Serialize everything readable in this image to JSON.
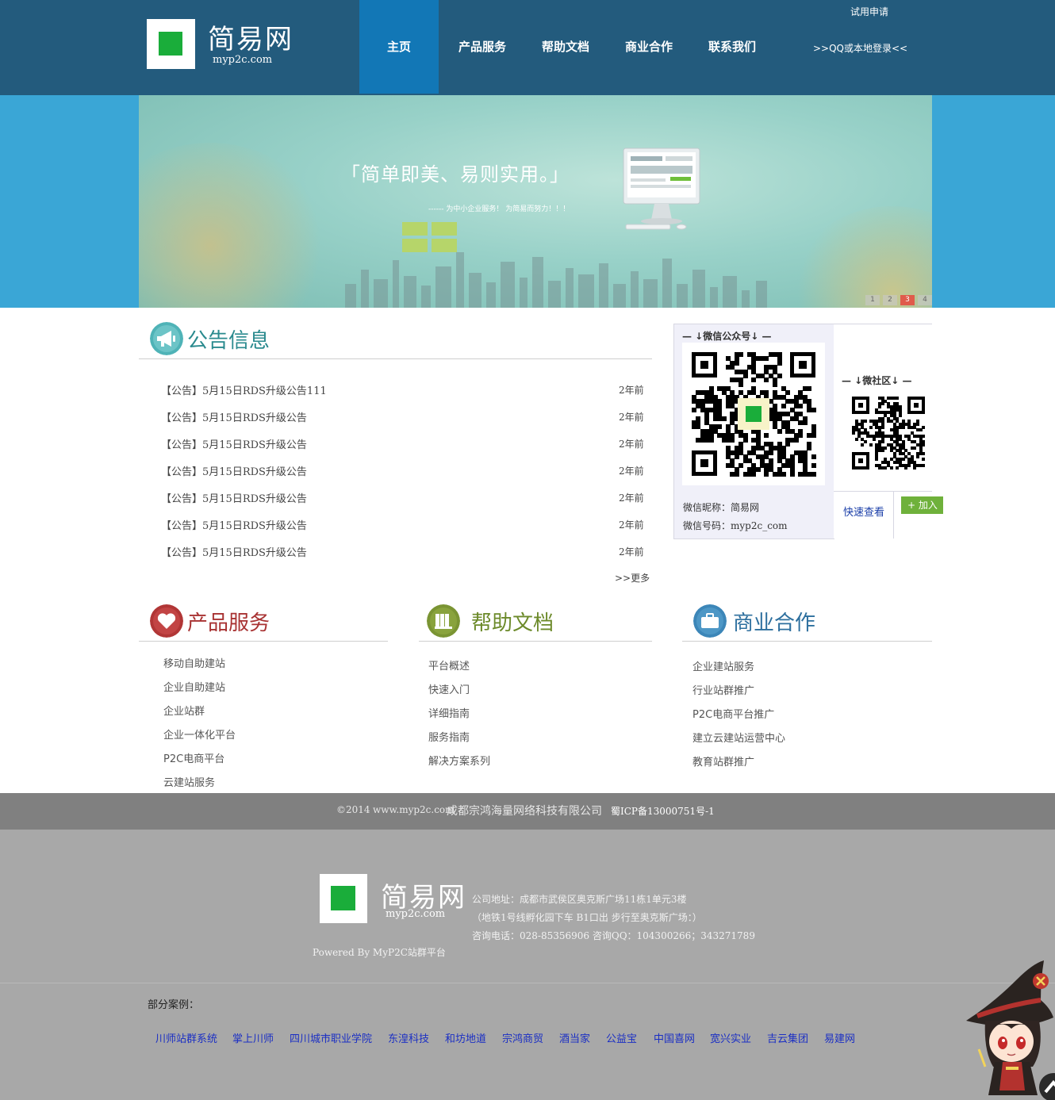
{
  "header": {
    "logo_title": "简易网",
    "logo_sub": "myp2c.com",
    "nav": [
      {
        "label": "主页",
        "active": true
      },
      {
        "label": "产品服务",
        "active": false
      },
      {
        "label": "帮助文档",
        "active": false
      },
      {
        "label": "商业合作",
        "active": false
      },
      {
        "label": "联系我们",
        "active": false
      }
    ],
    "trial_label": "试用申请",
    "qq_login_label": ">>QQ或本地登录<<"
  },
  "banner": {
    "slogan": "「简单即美、易则实用。」",
    "sub": "------ 为中小企业服务！ 为简易而努力！！！",
    "pager": [
      "1",
      "2",
      "3",
      "4"
    ],
    "active_page": "3"
  },
  "notices": {
    "title": "公告信息",
    "items": [
      {
        "title": "【公告】5月15日RDS升级公告111",
        "date": "2年前"
      },
      {
        "title": "【公告】5月15日RDS升级公告",
        "date": "2年前"
      },
      {
        "title": "【公告】5月15日RDS升级公告",
        "date": "2年前"
      },
      {
        "title": "【公告】5月15日RDS升级公告",
        "date": "2年前"
      },
      {
        "title": "【公告】5月15日RDS升级公告",
        "date": "2年前"
      },
      {
        "title": "【公告】5月15日RDS升级公告",
        "date": "2年前"
      },
      {
        "title": "【公告】5月15日RDS升级公告",
        "date": "2年前"
      }
    ],
    "more": ">>更多"
  },
  "wechat": {
    "official_head": "— ↓微信公众号↓ —",
    "community_head": "— ↓微社区↓ —",
    "nickname": "微信昵称：简易网",
    "account": "微信号码：myp2c_com",
    "quick_view": "快速查看",
    "add_label": "+ 加入"
  },
  "products": {
    "title": "产品服务",
    "items": [
      "移动自助建站",
      "企业自助建站",
      "企业站群",
      "企业一体化平台",
      "P2C电商平台",
      "云建站服务"
    ]
  },
  "help": {
    "title": "帮助文档",
    "items": [
      "平台概述",
      "快速入门",
      "详细指南",
      "服务指南",
      "解决方案系列"
    ]
  },
  "cooperation": {
    "title": "商业合作",
    "items": [
      "企业建站服务",
      "行业站群推广",
      "P2C电商平台推广",
      "建立云建站运营中心",
      "教育站群推广"
    ]
  },
  "footbar": {
    "copyright": "©2014",
    "domain": "www.myp2c.com",
    "company": "成都宗鸿海量网络科技有限公司",
    "icp": "蜀ICP备13000751号-1"
  },
  "footer": {
    "logo_title": "简易网",
    "logo_sub": "myp2c.com",
    "address": "公司地址：成都市武侯区奥克斯广场11栋1单元3楼",
    "route": "（地铁1号线孵化园下车 B1口出 步行至奥克斯广场：）",
    "contact": "咨询电话：028-85356906 咨询QQ：104300266；343271789",
    "powered": "Powered By MyP2C站群平台",
    "cases_label": "部分案例：",
    "cases": [
      "川师站群系统",
      "掌上川师",
      "四川城市职业学院",
      "东湟科技",
      "和坊地道",
      "宗鸿商贸",
      "酒当家",
      "公益宝",
      "中国喜网",
      "宽兴实业",
      "吉云集团",
      "易建网"
    ]
  },
  "colors": {
    "header_bg": "#235b7d",
    "nav_active": "#1277b6",
    "banner_bg": "#3aa6d6",
    "notice_accent": "#2a8a8e",
    "products_accent": "#a83232",
    "help_accent": "#6c8a2a",
    "coop_accent": "#2d6f9e"
  }
}
